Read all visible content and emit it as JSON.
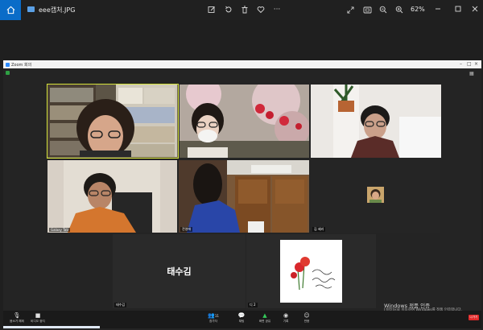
{
  "viewer": {
    "file_name": "eee캡처.JPG",
    "zoom_level": "62%",
    "icons": [
      "home-icon",
      "edit-icon",
      "rotate-icon",
      "delete-icon",
      "heart-icon",
      "more-icon",
      "fullscreen-icon",
      "fit-icon",
      "zoom-out-icon",
      "zoom-in-icon"
    ],
    "more_glyph": "···",
    "accent": "#0a6cc8"
  },
  "zoom_app": {
    "window_title": "Zoom 회의",
    "participants": [
      {
        "name": ""
      },
      {
        "name": ""
      },
      {
        "name": ""
      },
      {
        "name": "Galaxy Tab"
      },
      {
        "name": "전영애"
      },
      {
        "name": "김 혜리"
      },
      {
        "name": "태수김",
        "tile_label": "태수김"
      },
      {
        "name": "디 2"
      }
    ],
    "active_speaker_color": "#d4e23a",
    "toolbar": [
      {
        "label": "음소거 해제",
        "icon": "mic-muted-icon"
      },
      {
        "label": "비디오 중지",
        "icon": "video-icon"
      },
      {
        "label": "참가자",
        "icon": "participants-icon"
      },
      {
        "label": "채팅",
        "icon": "chat-icon"
      },
      {
        "label": "화면 공유",
        "icon": "share-screen-icon"
      },
      {
        "label": "기록",
        "icon": "record-icon"
      },
      {
        "label": "반응",
        "icon": "reactions-icon"
      }
    ],
    "participant_count": "11",
    "leave_label": "나가기",
    "leave_color": "#e02828"
  },
  "watermark": {
    "line1": "Windows 정품 인증",
    "line2": "[설정]으로 이동하여 Windows를 정품 인증합니다."
  }
}
